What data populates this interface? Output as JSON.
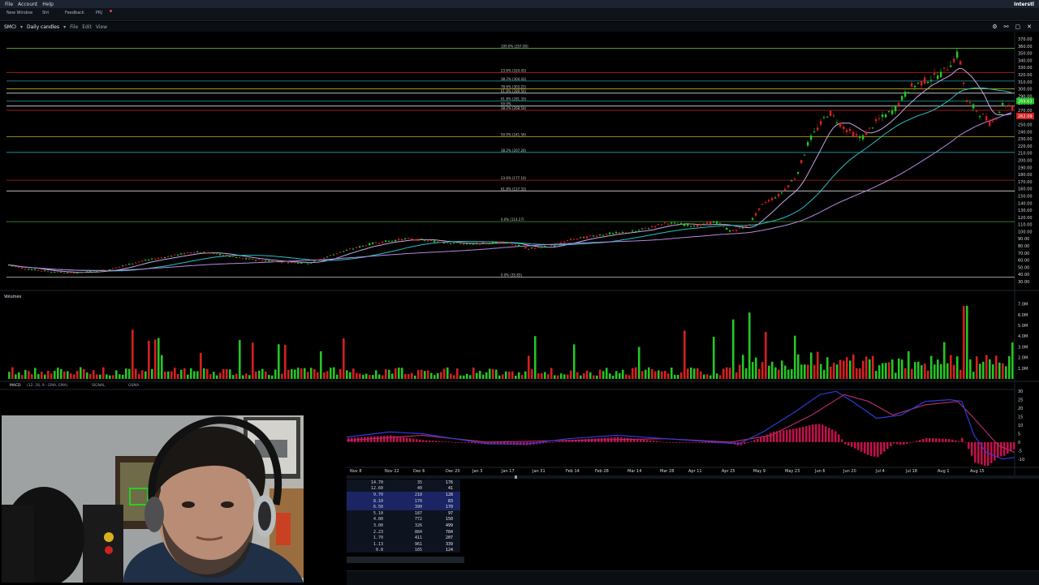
{
  "menubar": {
    "items": [
      "File",
      "Account",
      "Help"
    ],
    "brand": "Interstl"
  },
  "toolbar": {
    "buttons": [
      "New Window",
      "Sht",
      "Feedback",
      "PRJ"
    ]
  },
  "chart_header": {
    "symbol": "SMCI",
    "interval": "Daily candles",
    "menus": [
      "File",
      "Edit",
      "View"
    ]
  },
  "price_axis": [
    "370.00",
    "360.00",
    "350.00",
    "340.00",
    "330.00",
    "320.00",
    "310.00",
    "300.00",
    "290.00",
    "280.00",
    "270.00",
    "260.00",
    "250.00",
    "240.00",
    "230.00",
    "220.00",
    "210.00",
    "200.00",
    "190.00",
    "180.00",
    "170.00",
    "160.00",
    "150.00",
    "140.00",
    "130.00",
    "120.00",
    "110.00",
    "100.00",
    "90.00",
    "80.00",
    "70.00",
    "60.00",
    "50.00",
    "40.00",
    "30.00"
  ],
  "volume_panel": {
    "title": "Volumes",
    "axis": [
      "7.0M",
      "6.0M",
      "5.0M",
      "4.0M",
      "3.0M",
      "2.0M",
      "1.0M"
    ]
  },
  "macd_panel": {
    "title": "MACD",
    "params": "(12, 26, 9 - EMA, EMA)",
    "signal_label": "SIGNAL",
    "osma_label": "OSMA",
    "axis": [
      "30",
      "25",
      "20",
      "15",
      "10",
      "5",
      "0",
      "-5",
      "-10"
    ]
  },
  "date_axis": [
    "Nov 8",
    "Nov 22",
    "Dec 6",
    "Dec 20",
    "Jan 3",
    "Jan 17",
    "Jan 31",
    "Feb 14",
    "Feb 28",
    "Mar 14",
    "Mar 28",
    "Apr 11",
    "Apr 25",
    "May 9",
    "May 23",
    "Jun 6",
    "Jun 20",
    "Jul 4",
    "Jul 18",
    "Aug 1",
    "Aug 15"
  ],
  "fib_labels": [
    "100.0% (357.00)",
    "23.6% (324.43)",
    "38.2% (304.43)",
    "78.6% (303.22)",
    "61.8% (289.50)",
    "61.8% (281.33)",
    "50.0%",
    "38.2% (268.54)",
    "50.0% (241.56)",
    "38.2% (207.26)",
    "23.6% (177.10)",
    "61.8% (157.33)",
    "0.0% (114.27)",
    "0.0% (35.83)"
  ],
  "price_tags": {
    "current": "269.63",
    "bid": "262.09"
  },
  "orders": [
    {
      "price": "14.70",
      "qty": "35",
      "total": "176"
    },
    {
      "price": "12.60",
      "qty": "40",
      "total": "41"
    },
    {
      "price": "9.70",
      "qty": "218",
      "total": "128"
    },
    {
      "price": "8.10",
      "qty": "170",
      "total": "83"
    },
    {
      "price": "6.50",
      "qty": "390",
      "total": "170"
    },
    {
      "price": "5.10",
      "qty": "187",
      "total": "97"
    },
    {
      "price": "4.00",
      "qty": "772",
      "total": "150"
    },
    {
      "price": "3.00",
      "qty": "326",
      "total": "499"
    },
    {
      "price": "2.23",
      "qty": "884",
      "total": "784"
    },
    {
      "price": "1.70",
      "qty": "411",
      "total": "207"
    },
    {
      "price": "1.13",
      "qty": "961",
      "total": "339"
    },
    {
      "price": "0.8",
      "qty": "165",
      "total": "124"
    }
  ],
  "colors": {
    "up": "#23c623",
    "down": "#d42020",
    "ma_fast": "#c9a6e8",
    "ma_mid": "#27c0c8",
    "ma_slow": "#b88ae0",
    "macd_line": "#2d3cd8",
    "signal_line": "#b02a6a",
    "osma": "#c0104a",
    "background": "#000000"
  }
}
